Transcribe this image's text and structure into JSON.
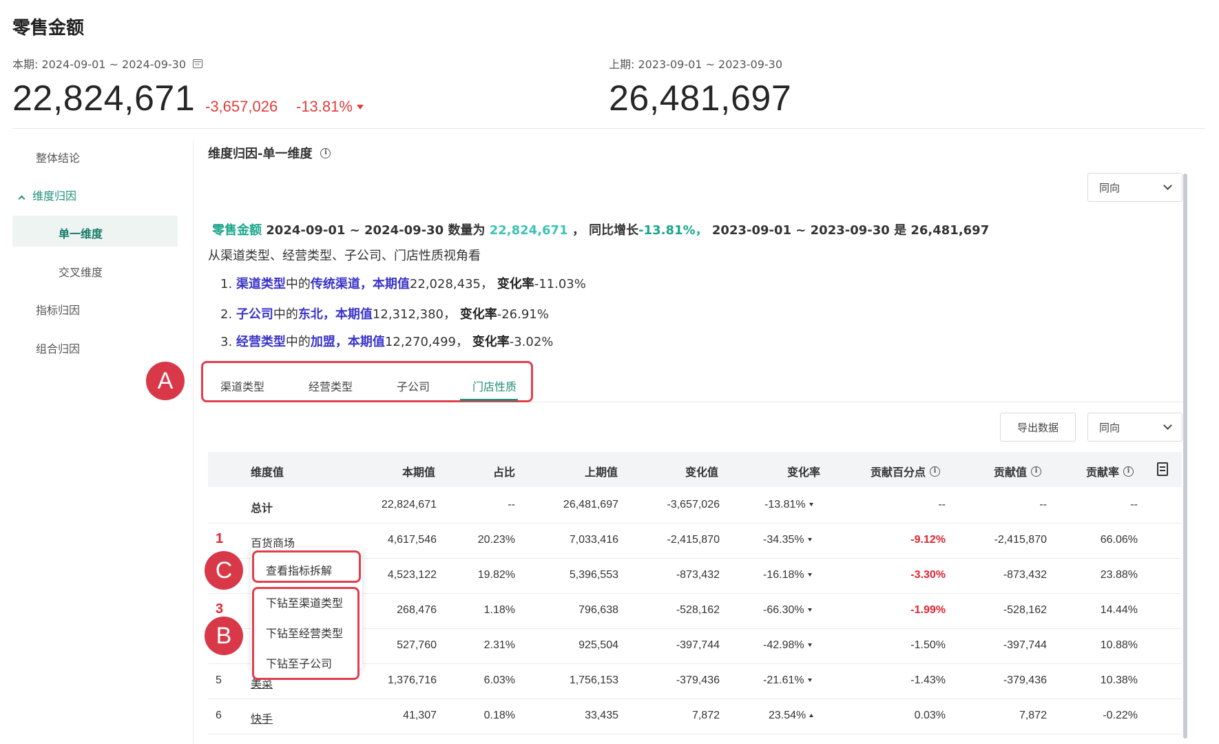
{
  "header": {
    "title": "零售金额",
    "current_period": "本期: 2024-09-01 ~ 2024-09-30",
    "previous_period": "上期: 2023-09-01 ~ 2023-09-30",
    "current_value": "22,824,671",
    "previous_value": "26,481,697",
    "delta_abs": "-3,657,026",
    "delta_pct": "-13.81%",
    "calendar_badge": "vs"
  },
  "sidebar": {
    "items": [
      {
        "label": "整体结论"
      },
      {
        "label": "维度归因"
      },
      {
        "label": "单一维度"
      },
      {
        "label": "交叉维度"
      },
      {
        "label": "指标归因"
      },
      {
        "label": "组合归因"
      }
    ]
  },
  "section": {
    "title": "维度归因-单一维度",
    "direction_select": "同向"
  },
  "summary": {
    "metric": "零售金额",
    "period_cur": "2024-09-01 ~ 2024-09-30",
    "count_label": "数量为",
    "value": "22,824,671",
    "sep": "，",
    "yoy_label": "同比增长",
    "yoy": "-13.81%，",
    "period_prev": "2023-09-01 ~ 2023-09-30",
    "is": "是",
    "prev_value": "26,481,697",
    "perspective": "从渠道类型、经营类型、子公司、门店性质视角看",
    "findings": [
      {
        "no": "1.",
        "dim": "渠道类型",
        "mid": "中的",
        "val": "传统渠道，",
        "cur_label": "本期值",
        "cur": "22,028,435，",
        "rate_label": "变化率",
        "rate": "-11.03%"
      },
      {
        "no": "2.",
        "dim": "子公司",
        "mid": "中的",
        "val": "东北，",
        "cur_label": "本期值",
        "cur": "12,312,380，",
        "rate_label": "变化率",
        "rate": "-26.91%"
      },
      {
        "no": "3.",
        "dim": "经营类型",
        "mid": "中的",
        "val": "加盟，",
        "cur_label": "本期值",
        "cur": "12,270,499，",
        "rate_label": "变化率",
        "rate": "-3.02%"
      }
    ]
  },
  "tabs": [
    {
      "label": "渠道类型"
    },
    {
      "label": "经营类型"
    },
    {
      "label": "子公司"
    },
    {
      "label": "门店性质"
    }
  ],
  "toolbar": {
    "export_label": "导出数据",
    "direction_select": "同向"
  },
  "annotations": {
    "a": "A",
    "b": "B",
    "c": "C"
  },
  "table": {
    "headers": [
      "维度值",
      "本期值",
      "占比",
      "上期值",
      "变化值",
      "变化率",
      "贡献百分点",
      "贡献值",
      "贡献率"
    ],
    "total": {
      "name": "总计",
      "cur": "22,824,671",
      "share": "--",
      "prev": "26,481,697",
      "change": "-3,657,026",
      "rate": "-13.81%",
      "pp": "--",
      "contrib": "--",
      "contrib_rate": "--"
    },
    "rows": [
      {
        "rank": "1",
        "name": "百货商场",
        "cur": "4,617,546",
        "share": "20.23%",
        "prev": "7,033,416",
        "change": "-2,415,870",
        "rate": "-34.35%",
        "pp": "-9.12%",
        "contrib": "-2,415,870",
        "contrib_rate": "66.06%"
      },
      {
        "rank": "",
        "name": "",
        "cur": "4,523,122",
        "share": "19.82%",
        "prev": "5,396,553",
        "change": "-873,432",
        "rate": "-16.18%",
        "pp": "-3.30%",
        "contrib": "-873,432",
        "contrib_rate": "23.88%"
      },
      {
        "rank": "3",
        "name": "",
        "cur": "268,476",
        "share": "1.18%",
        "prev": "796,638",
        "change": "-528,162",
        "rate": "-66.30%",
        "pp": "-1.99%",
        "contrib": "-528,162",
        "contrib_rate": "14.44%"
      },
      {
        "rank": "",
        "name": "",
        "cur": "527,760",
        "share": "2.31%",
        "prev": "925,504",
        "change": "-397,744",
        "rate": "-42.98%",
        "pp": "-1.50%",
        "contrib": "-397,744",
        "contrib_rate": "10.88%"
      },
      {
        "rank": "5",
        "name": "美菜",
        "cur": "1,376,716",
        "share": "6.03%",
        "prev": "1,756,153",
        "change": "-379,436",
        "rate": "-21.61%",
        "pp": "-1.43%",
        "contrib": "-379,436",
        "contrib_rate": "10.38%"
      },
      {
        "rank": "6",
        "name": "快手",
        "cur": "41,307",
        "share": "0.18%",
        "prev": "33,435",
        "change": "7,872",
        "rate": "23.54%",
        "pp": "0.03%",
        "contrib": "7,872",
        "contrib_rate": "-0.22%"
      }
    ]
  },
  "context_menu": {
    "view_breakdown": "查看指标拆解",
    "drill_channel": "下钻至渠道类型",
    "drill_business": "下钻至经营类型",
    "drill_subsidiary": "下钻至子公司"
  },
  "colors": {
    "accent": "#1d8f78",
    "negative": "#e0242f",
    "highlight": "#e23d4c",
    "purple": "#3a34c8"
  }
}
